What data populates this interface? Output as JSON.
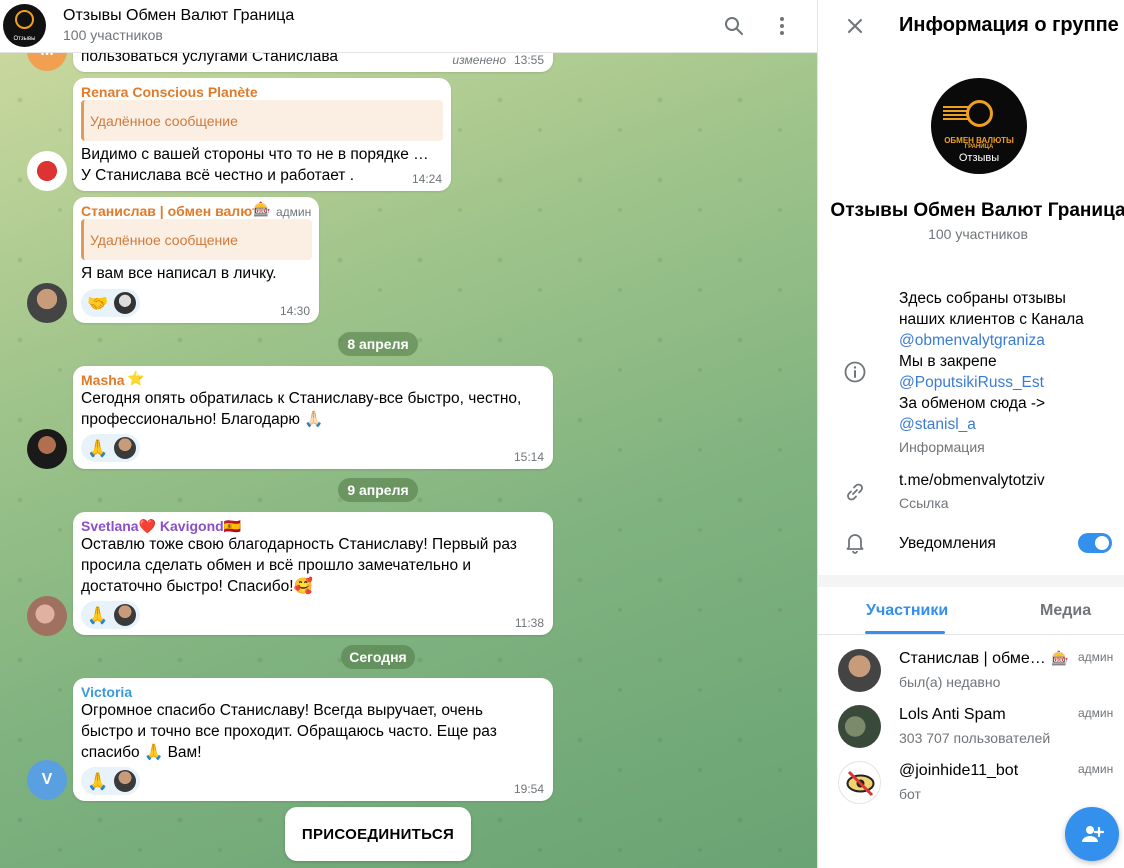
{
  "chat": {
    "title": "Отзывы Обмен Валют Граница",
    "subtitle": "100 участников",
    "header_avatar_caption": "Отзывы",
    "messages": [
      {
        "text": "пользоваться услугами Станислава",
        "edited": "изменено",
        "time": "13:55",
        "avatar_letter": "M",
        "avatar_color": "#f0a050"
      },
      {
        "sender": "Renara Conscious Planète",
        "sender_color": "#e07b2a",
        "quote": "Удалённое сообщение",
        "text_line1": "Видимо с вашей стороны что то не в порядке …",
        "text_line2": "У Станислава всё честно и работает .",
        "time": "14:24"
      },
      {
        "sender": "Станислав | обмен валют",
        "sender_color": "#e07b2a",
        "badge_emoji": "🎰",
        "role": "админ",
        "quote": "Удалённое сообщение",
        "text": "Я вам все написал в личку.",
        "reaction": "🤝",
        "time": "14:30"
      },
      {
        "sender": "Masha",
        "sender_color": "#e07b2a",
        "badge_emoji": "⭐",
        "text_line1": "Сегодня опять обратилась к Станиславу-все быстро, честно,",
        "text_line2": "профессионально! Благодарю 🙏🏻",
        "reaction": "🙏",
        "time": "15:14"
      },
      {
        "sender": "Svetlana❤️ Kavigond🇪🇸",
        "sender_color": "#8b4fc8",
        "text_line1": "Оставлю тоже свою благодарность Станиславу! Первый раз",
        "text_line2": "просила сделать обмен и всё прошло замечательно и",
        "text_line3": "достаточно быстро! Спасибо!🥰",
        "reaction": "🙏",
        "time": "11:38"
      },
      {
        "sender": "Victoria",
        "sender_color": "#3a9ad9",
        "text_line1": "Огромное спасибо Станиславу! Всегда выручает, очень",
        "text_line2": "быстро и точно все проходит. Обращаюсь часто. Еще раз",
        "text_line3": "спасибо 🙏 Вам!",
        "reaction": "🙏",
        "time": "19:54",
        "avatar_letter": "V",
        "avatar_color": "#5aa0e0"
      }
    ],
    "dates": {
      "d1": "8 апреля",
      "d2": "9 апреля",
      "d3": "Сегодня"
    },
    "join_label": "ПРИСОЕДИНИТЬСЯ"
  },
  "panel": {
    "title": "Информация о группе",
    "group_name": "Отзывы Обмен Валют Граница",
    "member_count": "100 участников",
    "avatar_brand": "ОБМЕН ВАЛЮТЫ",
    "avatar_brand_sub": "ГРАНИЦА",
    "avatar_caption": "Отзывы",
    "description": {
      "line1": "Здесь собраны отзывы",
      "line2": "наших клиентов с Канала",
      "link1": "@obmenvalytgraniza",
      "line3": "Мы в закрепе",
      "link2": "@PoputsikiRuss_Est",
      "line4": "За обменом сюда ->",
      "link3": "@stanisl_a",
      "label": "Информация"
    },
    "link": {
      "value": "t.me/obmenvalytotziv",
      "label": "Ссылка"
    },
    "notifications": {
      "label": "Уведомления",
      "enabled": true
    },
    "tabs": [
      {
        "label": "Участники",
        "active": true
      },
      {
        "label": "Медиа",
        "active": false
      }
    ],
    "members": [
      {
        "name": "Станислав | обме…",
        "badge_emoji": "🎰",
        "status": "был(а) недавно",
        "role": "админ"
      },
      {
        "name": "Lols Anti Spam",
        "status": "303 707 пользователей",
        "role": "админ"
      },
      {
        "name": "@joinhide11_bot",
        "status": "бот",
        "role": "админ"
      }
    ]
  },
  "colors": {
    "accent": "#3390ec",
    "sender_orange": "#e07b2a",
    "link": "#3a7bd5"
  }
}
